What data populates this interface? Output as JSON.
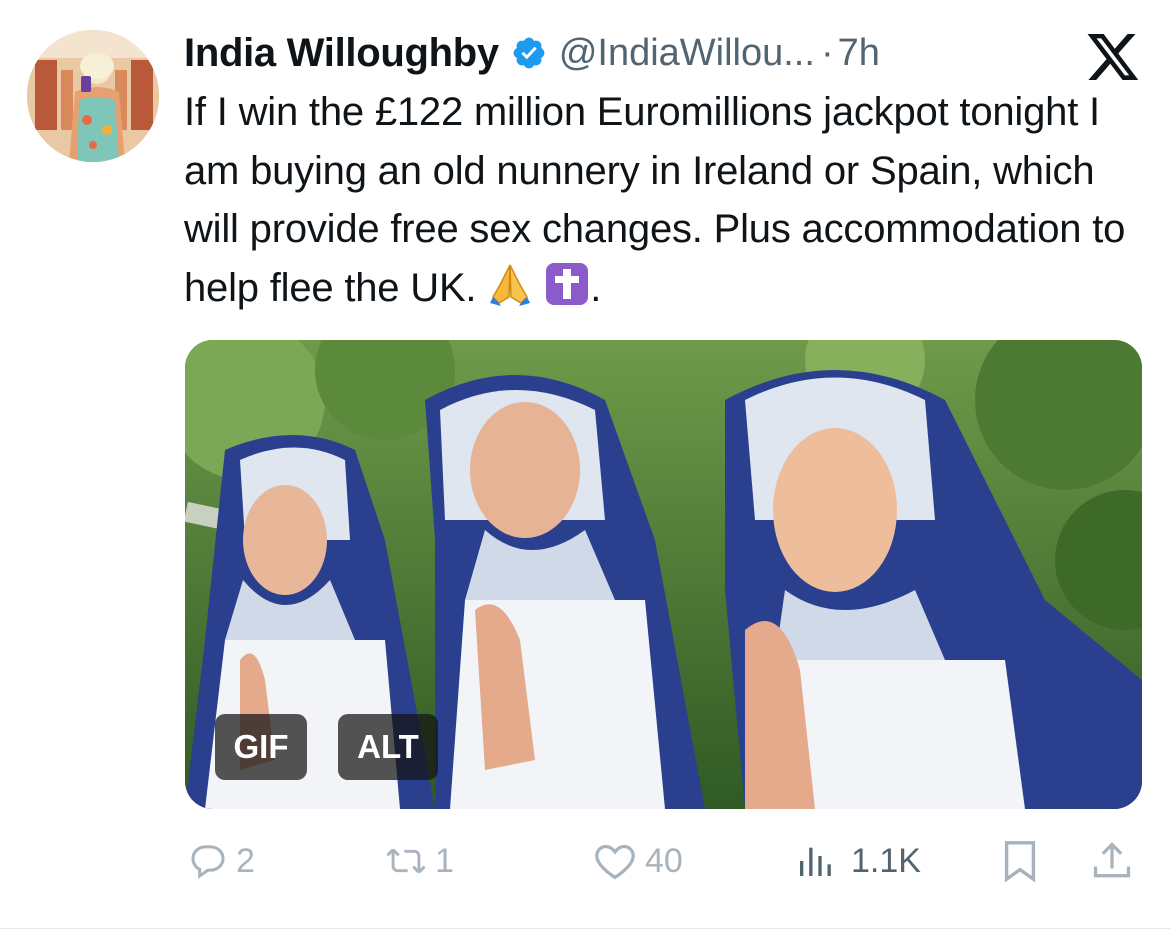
{
  "tweet": {
    "author_name": "India Willoughby",
    "handle": "@IndiaWillou...",
    "separator": "·",
    "time": "7h",
    "text": "If I win the £122 million Euromillions jackpot tonight I am buying an old nunnery in Ireland or Spain, which will provide free sex changes. Plus accommodation to help flee the UK.",
    "emojis": [
      "folded-hands",
      "latin-cross"
    ],
    "trailing_text": ".",
    "verified": true
  },
  "media": {
    "type": "gif",
    "gif_badge": "GIF",
    "alt_badge": "ALT"
  },
  "actions": {
    "replies": "2",
    "reposts": "1",
    "likes": "40",
    "views": "1.1K"
  },
  "icons": {
    "brand": "x-logo-icon",
    "verified": "verified-badge-icon",
    "reply": "reply-icon",
    "repost": "repost-icon",
    "like": "heart-icon",
    "views": "views-chart-icon",
    "bookmark": "bookmark-icon",
    "share": "share-icon"
  },
  "colors": {
    "text": "#0f1419",
    "secondary": "#536471",
    "action_gray": "#a8b3bd",
    "verified_blue": "#1d9bf0",
    "emoji_purple": "#8b5cc9"
  }
}
